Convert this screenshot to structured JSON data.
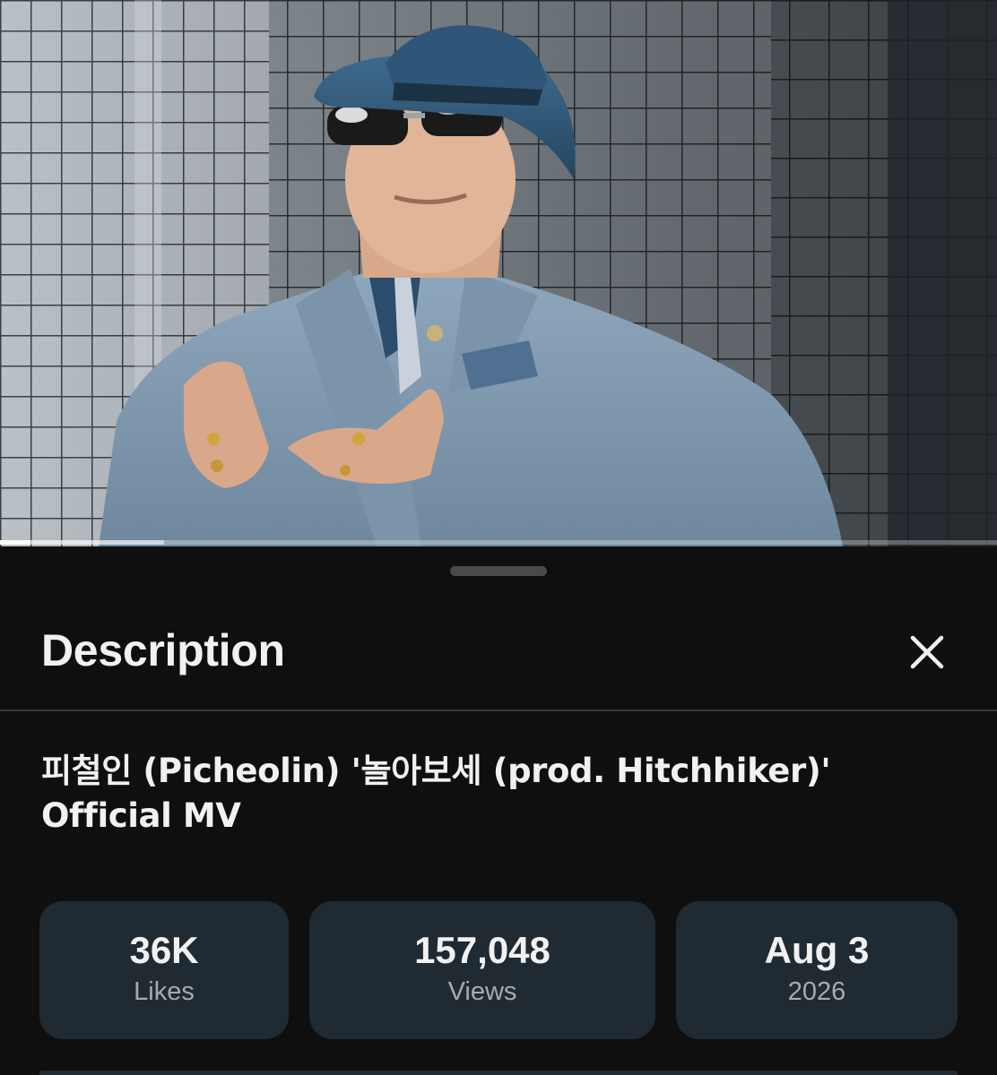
{
  "video": {
    "thumbnail_icon": "music-video-frame",
    "progress_fraction": 0.03,
    "buffered_fraction": 0.165
  },
  "sheet": {
    "title": "Description",
    "close_icon": "close-icon"
  },
  "video_info": {
    "title": "피철인 (Picheolin) '놀아보세 (prod. Hitchhiker)' Official MV"
  },
  "stats": {
    "likes": {
      "value": "36K",
      "label": "Likes"
    },
    "views": {
      "value": "157,048",
      "label": "Views"
    },
    "date": {
      "value": "Aug 3",
      "label": "2026"
    }
  },
  "colors": {
    "background": "#0f0f0f",
    "stat_box": "#1f2a33",
    "text_primary": "#f1f1f1",
    "text_secondary": "#aaaaaa"
  }
}
